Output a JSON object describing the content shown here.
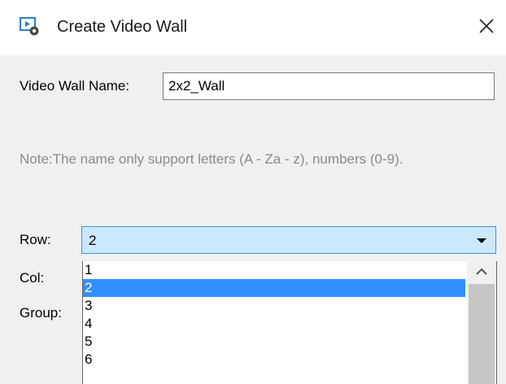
{
  "dialog": {
    "title": "Create Video Wall",
    "app_icon": "video-wall-settings-icon",
    "close_icon": "close-icon"
  },
  "form": {
    "name_label": "Video Wall Name:",
    "name_value": "2x2_Wall",
    "note": "Note:The name only support letters (A - Za - z), numbers (0-9).",
    "row_label": "Row:",
    "row_value": "2",
    "col_label": "Col:",
    "group_label": "Group:"
  },
  "dropdown": {
    "options": [
      "1",
      "2",
      "3",
      "4",
      "5",
      "6"
    ],
    "selected_index": 1,
    "scroll_up_icon": "chevron-up-icon",
    "arrow_icon": "caret-down-icon"
  },
  "colors": {
    "accent": "#3390ff",
    "select_bg": "#cce8ff",
    "select_border": "#3399dd",
    "note_text": "#8a8a8a",
    "dialog_bg": "#f0f0f0"
  }
}
